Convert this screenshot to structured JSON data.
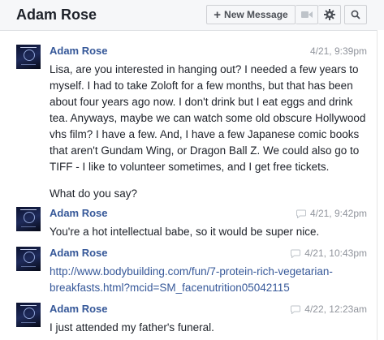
{
  "header": {
    "title": "Adam Rose",
    "new_message_label": "New Message"
  },
  "icons": {
    "plus": "plus-icon",
    "video": "video-camera-icon",
    "settings": "gear-icon",
    "search": "search-icon",
    "chat": "chat-bubble-icon"
  },
  "messages": [
    {
      "sender": "Adam Rose",
      "time": "4/21, 9:39pm",
      "paragraphs": [
        "Lisa, are you interested in hanging out? I needed a few years to myself. I had to take Zoloft for a few months, but that has been about four years ago now. I don't drink but I eat eggs and drink tea. Anyways, maybe we can watch some old obscure Hollywood vhs film? I have a few. And, I have a few Japanese comic books that aren't Gundam Wing, or Dragon Ball Z. We could also go to TIFF - I like to volunteer sometimes, and I get free tickets.",
        "What do you say?"
      ]
    },
    {
      "sender": "Adam Rose",
      "time": "4/21, 9:42pm",
      "paragraphs": [
        "You're a hot intellectual babe, so it would be super nice."
      ]
    },
    {
      "sender": "Adam Rose",
      "time": "4/21, 10:43pm",
      "link": "http://www.bodybuilding.com/fun/7-protein-rich-vegetarian-breakfasts.html?mcid=SM_facenutrition05042115"
    },
    {
      "sender": "Adam Rose",
      "time": "4/22, 12:23am",
      "paragraphs": [
        "I just attended my father's funeral."
      ]
    }
  ]
}
